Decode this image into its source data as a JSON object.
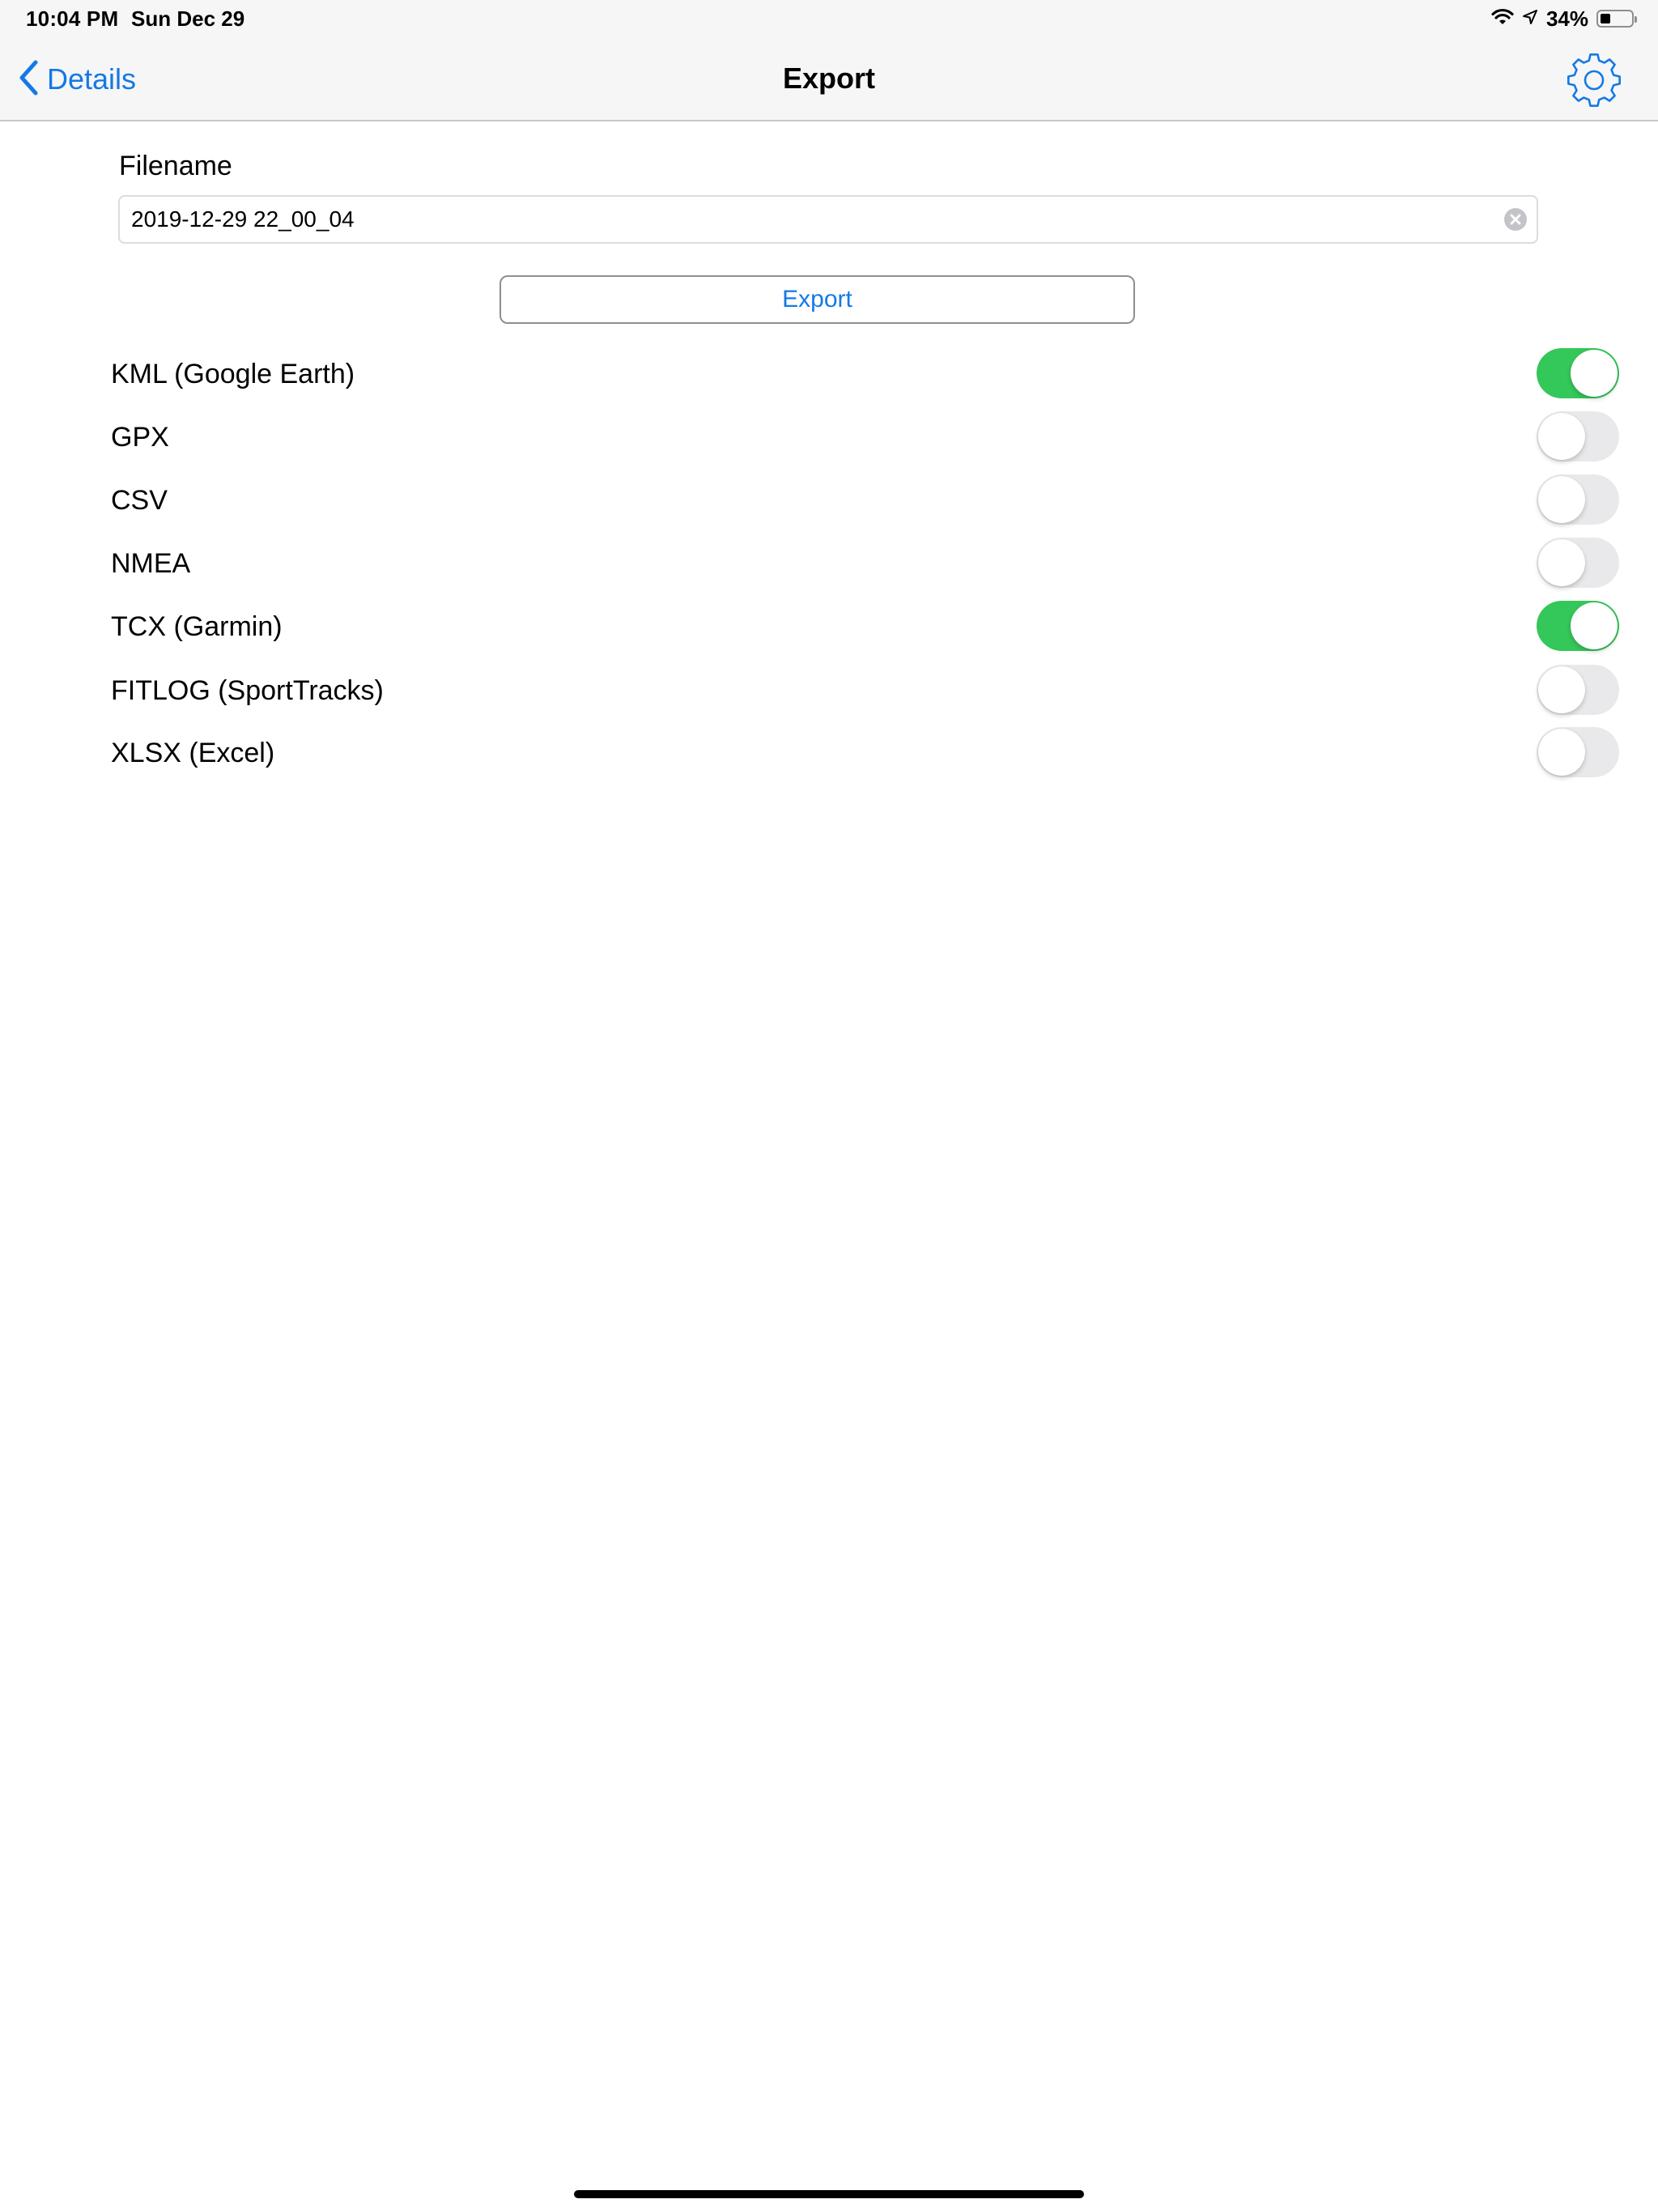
{
  "status_bar": {
    "time": "10:04 PM",
    "date": "Sun Dec 29",
    "battery_percent_text": "34%",
    "battery_level": 0.34
  },
  "nav": {
    "back_label": "Details",
    "title": "Export",
    "settings_icon": "gear-icon"
  },
  "form": {
    "filename_label": "Filename",
    "filename_value": "2019-12-29 22_00_04",
    "export_button_label": "Export"
  },
  "formats": [
    {
      "label": "KML (Google Earth)",
      "enabled": true
    },
    {
      "label": "GPX",
      "enabled": false
    },
    {
      "label": "CSV",
      "enabled": false
    },
    {
      "label": "NMEA",
      "enabled": false
    },
    {
      "label": "TCX (Garmin)",
      "enabled": true
    },
    {
      "label": "FITLOG (SportTracks)",
      "enabled": false
    },
    {
      "label": "XLSX (Excel)",
      "enabled": false
    }
  ],
  "colors": {
    "accent": "#1479e6",
    "toggle_on": "#34c759",
    "toggle_off": "#e9e9eb",
    "bar_background": "#f6f6f6"
  }
}
